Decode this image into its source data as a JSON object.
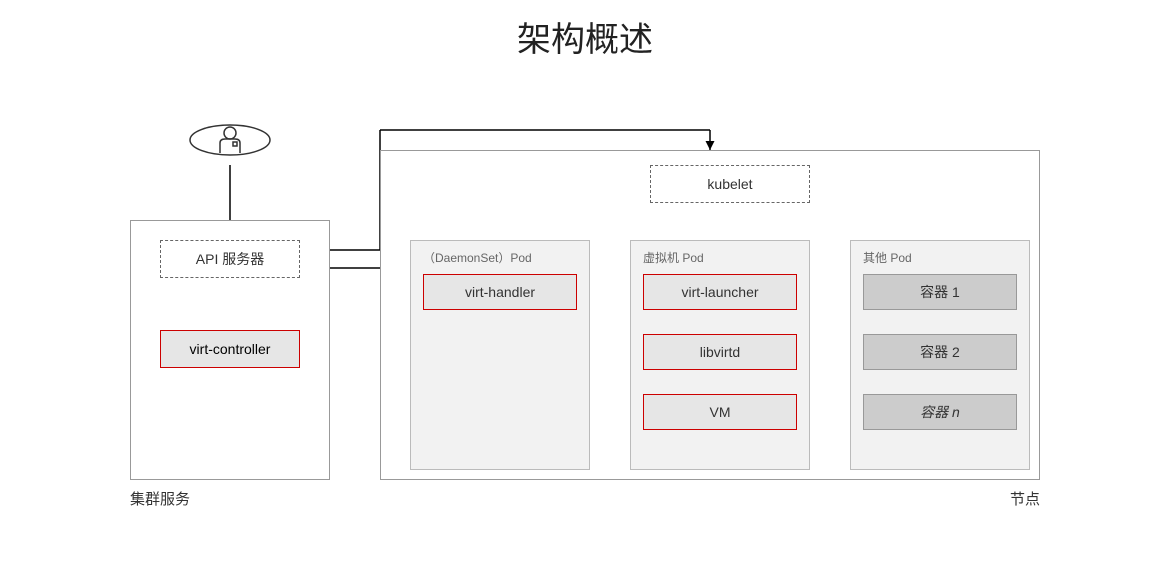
{
  "title": "架构概述",
  "cluster": {
    "label": "集群服务",
    "api_server": "API 服务器",
    "virt_controller": "virt-controller"
  },
  "node": {
    "label": "节点",
    "kubelet": "kubelet"
  },
  "daemonset_pod": {
    "title": "（DaemonSet）Pod",
    "virt_handler": "virt-handler"
  },
  "vm_pod": {
    "title": "虚拟机 Pod",
    "virt_launcher": "virt-launcher",
    "libvirtd": "libvirtd",
    "vm": "VM"
  },
  "other_pod": {
    "title": "其他 Pod",
    "container1": "容器 1",
    "container2": "容器 2",
    "container_n": "容器 n"
  }
}
